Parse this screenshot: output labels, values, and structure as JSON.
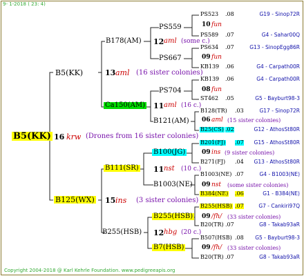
{
  "header": {
    "date": "9-  1-2018  ( 23:  4)"
  },
  "footer": {
    "copyright": "Copyright 2004-2018 @ Karl Kehrle Foundation.   www.pedigreeapis.org"
  },
  "colors": {
    "yellow": "#ffff00",
    "green": "#00dd00",
    "cyan": "#00ffff",
    "red": "#cc0000",
    "purple": "#7711aa",
    "blue": "#1111aa",
    "green_text": "#33aa33"
  },
  "root": {
    "name": "B5(KK)",
    "gen": "16",
    "code": "krw",
    "note": "(Drones from 16 sister colonies)"
  },
  "left": {
    "name": "B5(KK)",
    "gen": "13",
    "code": "aml",
    "note": "(16 sister colonies)",
    "b178": {
      "name": "B178(AM)",
      "gen": "12",
      "code": "aml",
      "note": "(some c.)"
    },
    "ca150": {
      "name": "Ca150(AM)",
      "gen": "11",
      "code": "aml",
      "note": "(16 c.)"
    },
    "ps559": "PS559",
    "ps667": "PS667",
    "ps704": "PS704",
    "b121": "B121(AM)",
    "g1": {
      "gen": "10",
      "code": "fun"
    },
    "g2": {
      "gen": "09",
      "code": "fun"
    },
    "g3": {
      "gen": "08",
      "code": "fun"
    },
    "g4": {
      "gen": "06",
      "code": "aml",
      "note": "(15 sister colonies)"
    }
  },
  "right": {
    "name": "B125(WX)",
    "gen": "15",
    "code": "ins",
    "note": "(3 sister colonies)",
    "b111": {
      "name": "B111(SR)",
      "gen": "11",
      "code": "nst",
      "note": "(10 c.)"
    },
    "b100": "B100(JG)",
    "b1003": "B1003(NE)",
    "b255hsb": {
      "name": "B255(HSB)",
      "gen": "12",
      "code": "hbg",
      "note": "(20 c.)"
    },
    "b255small": "B255(HSB)",
    "b7": "B7(HSB)",
    "g5": {
      "gen": "09",
      "code": "ins",
      "note": "(9 sister colonies)"
    },
    "g6": {
      "gen": "09",
      "code": "nst",
      "note": "(some sister colonies)"
    },
    "g7": {
      "gen": "09",
      "code": "/fh/",
      "note": "(33 sister colonies)"
    },
    "g8": {
      "gen": "09",
      "code": "/fh/",
      "note": "(33 sister colonies)"
    }
  },
  "leaves": [
    {
      "name": "PS523",
      "num": ".08",
      "src": "G19 - Sinop72R"
    },
    {
      "name": "PS589",
      "num": ".07",
      "src": "G4 - Sahar00Q"
    },
    {
      "name": "PS634",
      "num": ".07",
      "src": "G13 - SinopEgg86R"
    },
    {
      "name": "KB139",
      "num": ".06",
      "src": "G4 - Carpath00R"
    },
    {
      "name": "KB139",
      "num": ".06",
      "src": "G4 - Carpath00R"
    },
    {
      "name": "ST462",
      "num": ".05",
      "src": "G5 - Bayburt98-3"
    },
    {
      "name": "B128(TR)",
      "num": ".03",
      "src": "G17 - Sinop72R"
    },
    {
      "name": "B25(CS)",
      "num": ".02",
      "src": "G12 - AthosSt80R"
    },
    {
      "name": "B201(FJ)",
      "num": ".07",
      "src": "G15 - AthosSt80R"
    },
    {
      "name": "B271(FJ)",
      "num": ".04",
      "src": "G13 - AthosSt80R"
    },
    {
      "name": "B1003(NE)",
      "num": ".07",
      "src": "G4 - B1003(NE)"
    },
    {
      "name": "B384(NE)",
      "num": ".06",
      "src": "G1 - B384(NE)"
    },
    {
      "name": "B255(HSB)",
      "num": ".07",
      "src": "G7 - Cankiri97Q"
    },
    {
      "name": "B20(TR)",
      "num": ".07",
      "src": "G8 - Takab93aR"
    },
    {
      "name": "B507(HSB)",
      "num": ".08",
      "src": "G5 - Bayburt98-3"
    },
    {
      "name": "B20(TR)",
      "num": ".07",
      "src": "G8 - Takab93aR"
    }
  ]
}
